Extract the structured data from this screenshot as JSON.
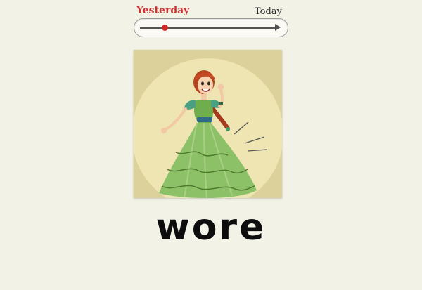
{
  "timeline": {
    "start_label": "Yesterday",
    "end_label": "Today",
    "position_fraction": 0.18,
    "accent_color": "#cf3030"
  },
  "illustration": {
    "icon": "woman-in-green-dress-waving",
    "background_color": "#ddd19b",
    "circle_color": "#efe5b2",
    "dress_color": "#8cc168"
  },
  "word": {
    "text": "wore"
  }
}
